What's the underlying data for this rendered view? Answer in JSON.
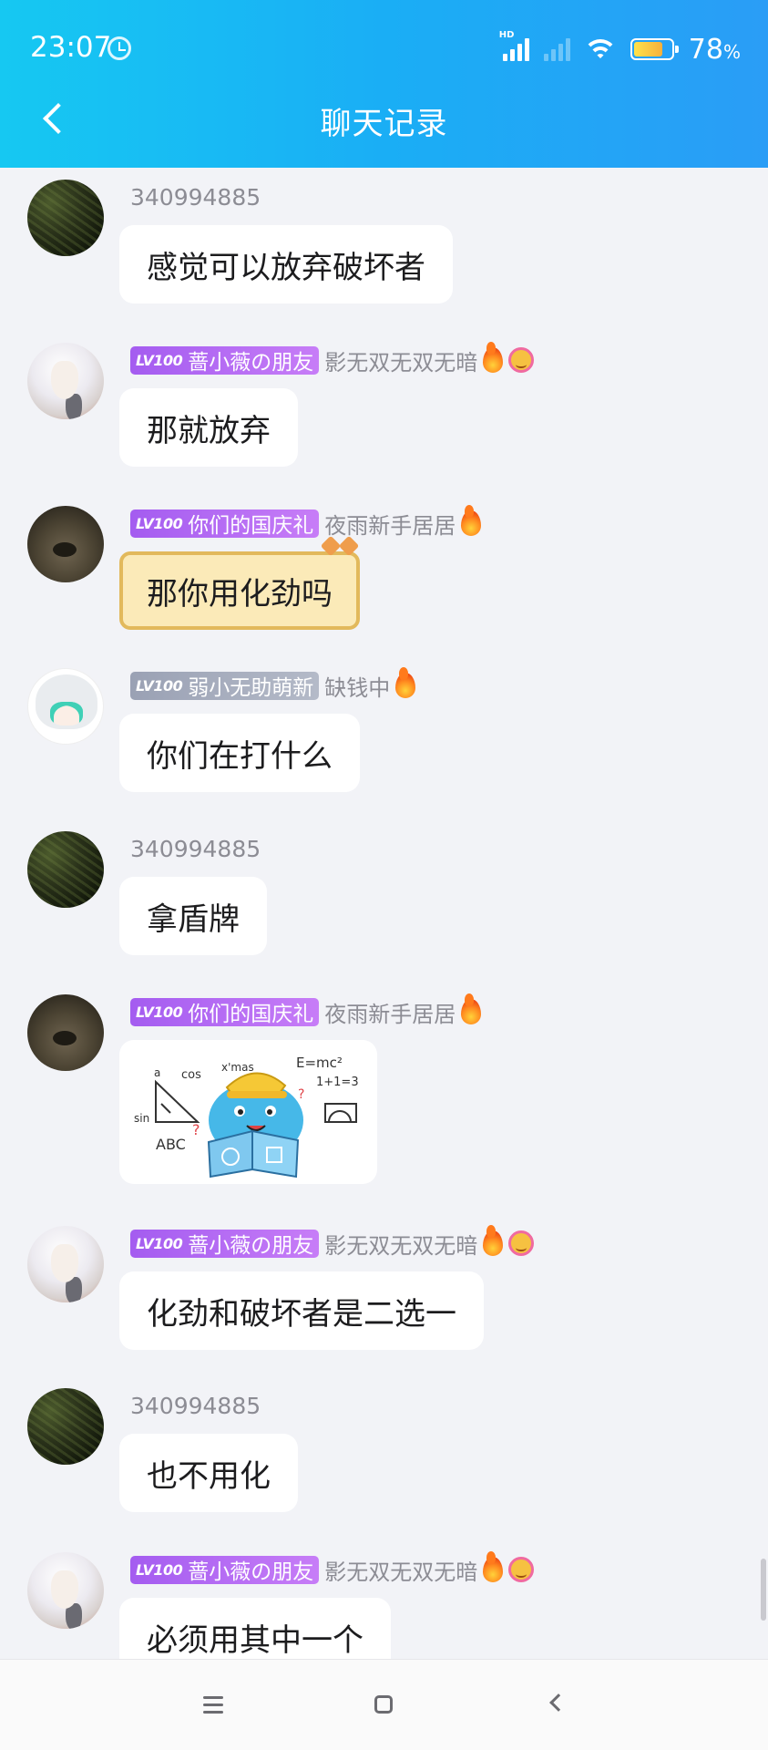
{
  "status_bar": {
    "time": "23:07",
    "battery": "78",
    "battery_unit": "%",
    "hd": "HD"
  },
  "header": {
    "title": "聊天记录"
  },
  "messages": [
    {
      "sender_id": "340994885",
      "text": "感觉可以放弃破坏者"
    },
    {
      "level": "LV100",
      "title_badge": "蔷小薇の朋友",
      "nickname": "影无双无双无暗",
      "text": "那就放弃"
    },
    {
      "level": "LV100",
      "title_badge": "你们的国庆礼",
      "nickname": "夜雨新手居居",
      "text": "那你用化劲吗"
    },
    {
      "level": "LV100",
      "title_badge": "弱小无助萌新",
      "nickname": "缺钱中",
      "text": "你们在打什么"
    },
    {
      "sender_id": "340994885",
      "text": "拿盾牌"
    },
    {
      "level": "LV100",
      "title_badge": "你们的国庆礼",
      "nickname": "夜雨新手居居",
      "sticker_text": {
        "a": "a",
        "cos": "cos",
        "xmas": "x'mas",
        "emc": "E=mc²",
        "math": "1+1=3",
        "sin": "sin",
        "abc": "ABC",
        "q1": "?",
        "q2": "?"
      }
    },
    {
      "level": "LV100",
      "title_badge": "蔷小薇の朋友",
      "nickname": "影无双无双无暗",
      "text": "化劲和破坏者是二选一"
    },
    {
      "sender_id": "340994885",
      "text": "也不用化"
    },
    {
      "level": "LV100",
      "title_badge": "蔷小薇の朋友",
      "nickname": "影无双无双无暗",
      "text": "必须用其中一个"
    }
  ],
  "colors": {
    "header_start": "#16c8f2",
    "header_end": "#2a9df6",
    "badge_purple": "#b06cf4",
    "badge_gray": "#a8aebd",
    "background": "#f2f3f7"
  }
}
